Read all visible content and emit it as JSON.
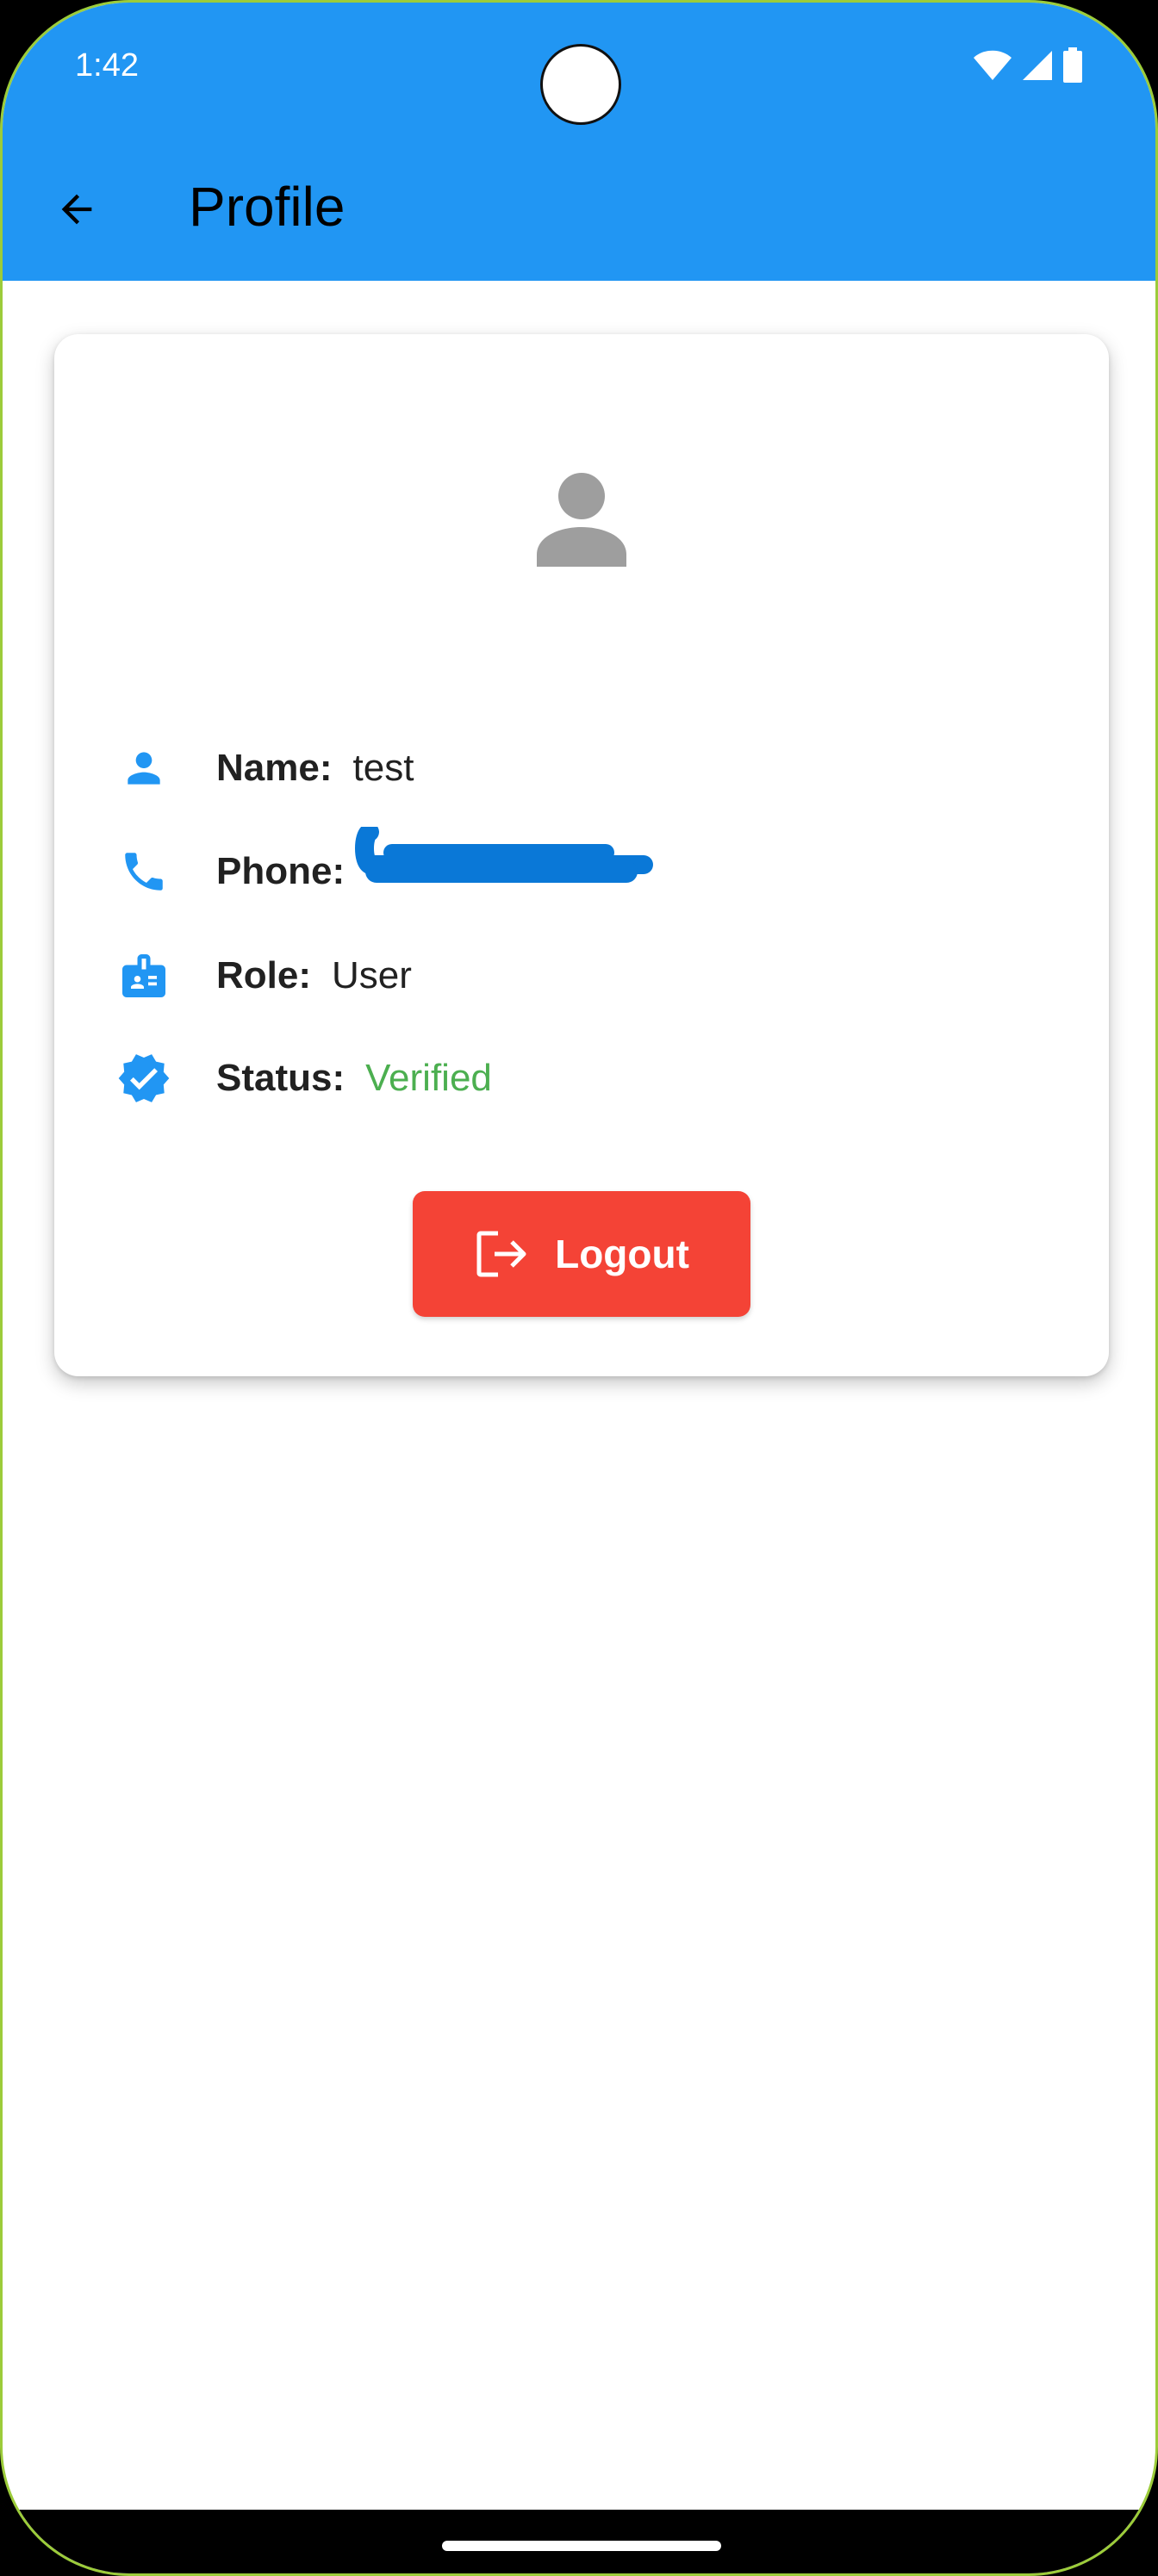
{
  "status_bar": {
    "time": "1:42"
  },
  "app_bar": {
    "title": "Profile",
    "back_icon": "arrow-back-icon"
  },
  "profile": {
    "avatar_icon": "person-icon",
    "fields": [
      {
        "icon": "person-icon",
        "label": "Name:",
        "value": "test"
      },
      {
        "icon": "phone-icon",
        "label": "Phone:",
        "value": ""
      },
      {
        "icon": "badge-icon",
        "label": "Role:",
        "value": "User"
      },
      {
        "icon": "verified-icon",
        "label": "Status:",
        "value": "Verified"
      }
    ],
    "logout_label": "Logout",
    "logout_icon": "logout-icon"
  },
  "colors": {
    "primary": "#2196f3",
    "logout": "#f44336",
    "verified": "#4caf50",
    "avatar_gray": "#9e9e9e",
    "redaction": "#0a78d7"
  }
}
